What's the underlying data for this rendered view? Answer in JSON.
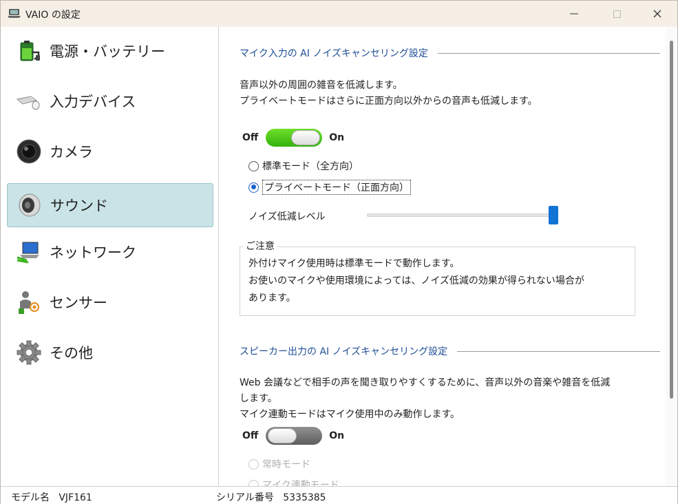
{
  "window": {
    "title": "VAIO の設定"
  },
  "sidebar": {
    "items": [
      {
        "label": "電源・バッテリー",
        "icon": "battery-plug-icon"
      },
      {
        "label": "入力デバイス",
        "icon": "keyboard-mouse-icon"
      },
      {
        "label": "カメラ",
        "icon": "camera-lens-icon"
      },
      {
        "label": "サウンド",
        "icon": "speaker-icon",
        "selected": true
      },
      {
        "label": "ネットワーク",
        "icon": "network-laptop-icon"
      },
      {
        "label": "センサー",
        "icon": "sensor-person-icon"
      },
      {
        "label": "その他",
        "icon": "gear-icon"
      }
    ]
  },
  "mic_section": {
    "heading": "マイク入力の AI ノイズキャンセリング設定",
    "desc_line1": "音声以外の周囲の雑音を低減します。",
    "desc_line2": "プライベートモードはさらに正面方向以外からの音声も低減します。",
    "toggle": {
      "off_label": "Off",
      "on_label": "On",
      "state": "on"
    },
    "radio_standard": "標準モード（全方向）",
    "radio_private": "プライベートモード（正面方向）",
    "selected_mode": "private",
    "slider_label": "ノイズ低減レベル",
    "slider_value": 1.0,
    "notice": {
      "title": "ご注意",
      "line1": "外付けマイク使用時は標準モードで動作します。",
      "line2": "お使いのマイクや使用環境によっては、ノイズ低減の効果が得られない場合が",
      "line3": "あります。"
    }
  },
  "speaker_section": {
    "heading": "スピーカー出力の AI ノイズキャンセリング設定",
    "desc_line1": "Web 会議などで相手の声を聞き取りやすくするために、音声以外の音楽や雑音を低減",
    "desc_line2": "します。",
    "desc_line3": "マイク連動モードはマイク使用中のみ動作します。",
    "toggle": {
      "off_label": "Off",
      "on_label": "On",
      "state": "off"
    },
    "radio_always": "常時モード",
    "radio_mic_linked": "マイク連動モード"
  },
  "statusbar": {
    "model_label": "モデル名",
    "model_value": "VJF161",
    "serial_label": "シリアル番号",
    "serial_value": "5335385"
  },
  "colors": {
    "accent_blue": "#1f4e96",
    "selected_bg": "#c9e3e6",
    "toggle_on": "#34b10e",
    "slider_thumb": "#1173d4"
  }
}
